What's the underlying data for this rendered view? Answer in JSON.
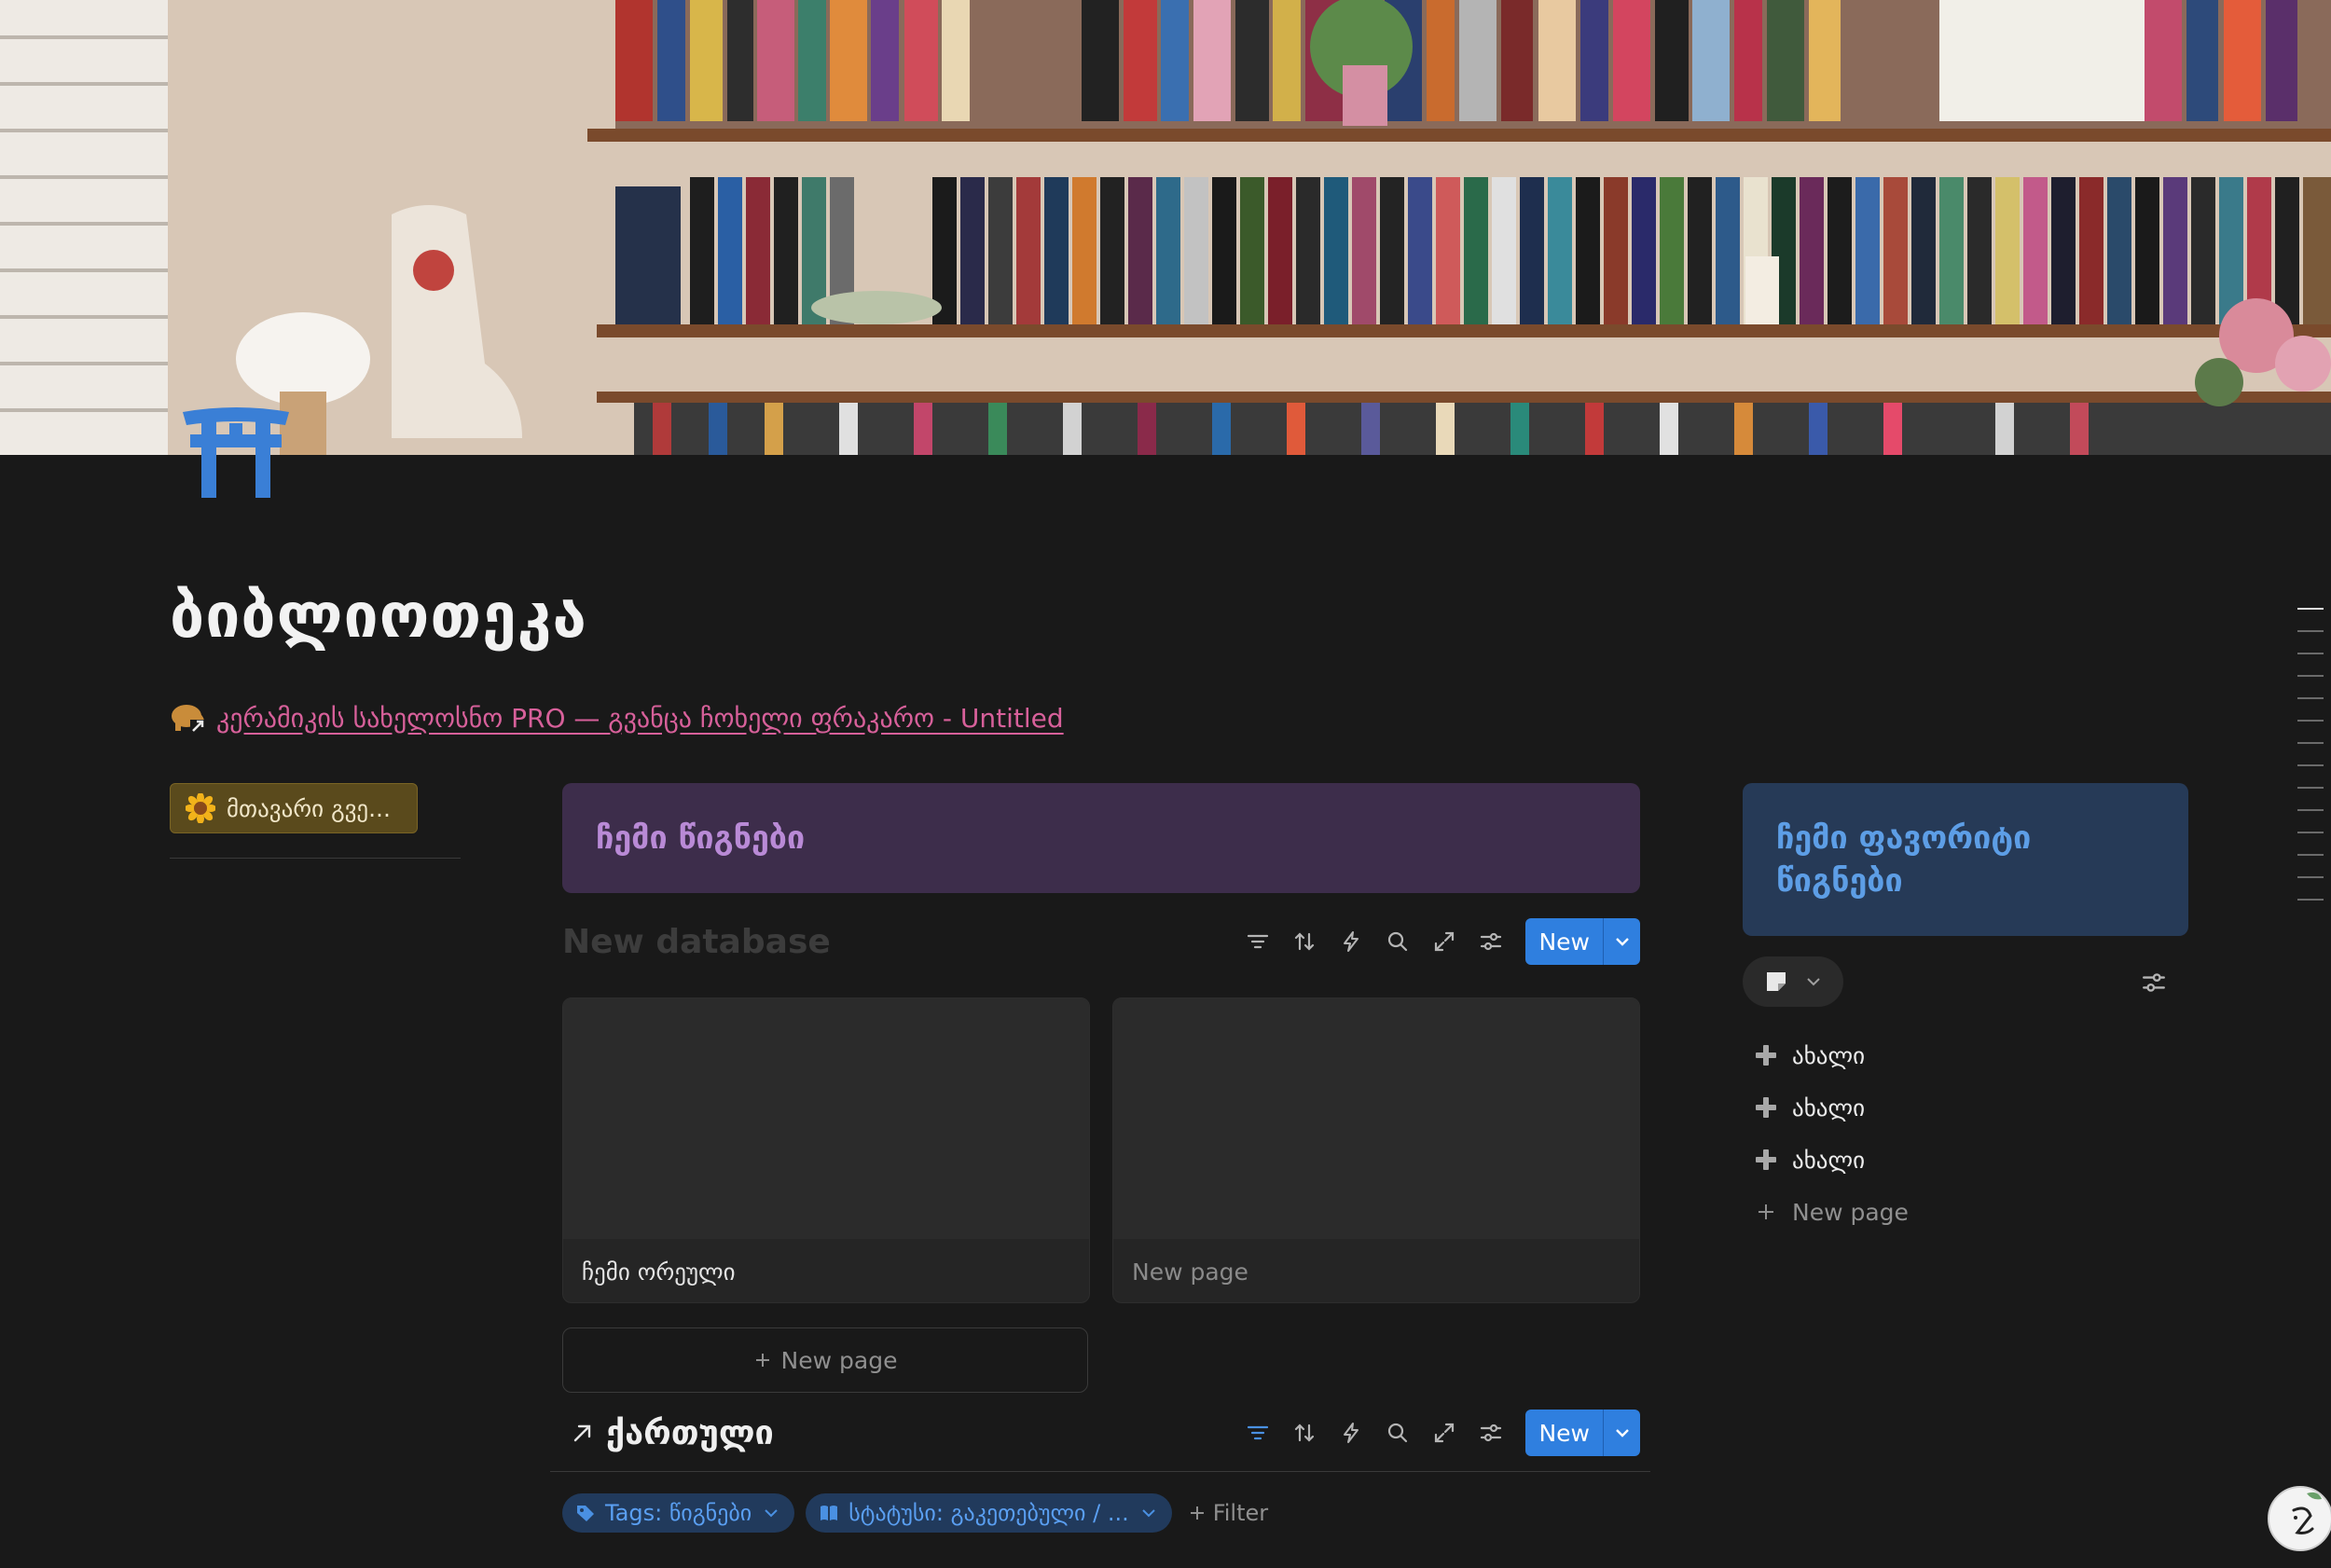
{
  "page": {
    "title": "ბიბლიოთეკა",
    "cover_description_icon": "bookshelf-cover-image",
    "page_icon": "torii-gate-icon"
  },
  "link": {
    "icon": "elephant-link-icon",
    "text": "კერამიკის სახელოსნო PRO — გვანცა ჩოხელი ფრაკარო - Untitled"
  },
  "left": {
    "home_button_icon": "sunflower-icon",
    "home_button_label": "მთავარი გვე..."
  },
  "middle": {
    "callout_title": "ჩემი წიგნები",
    "database_title": "New database",
    "new_label": "New",
    "cards": [
      {
        "caption": "ჩემი ორეული"
      },
      {
        "caption": "New page"
      }
    ],
    "new_page_label": "New page",
    "linked_db_title": "ქართული",
    "linked_new_label": "New",
    "filters": [
      {
        "icon": "tag-icon",
        "label": "Tags: წიგნები"
      },
      {
        "icon": "book-icon",
        "label": "სტატუსი: გაკეთებული / ..."
      }
    ],
    "add_filter_label": "Filter"
  },
  "right": {
    "callout_title_line1": "ჩემი ფავორიტი",
    "callout_title_line2": "წიგნები",
    "items": [
      {
        "label": "ახალი"
      },
      {
        "label": "ახალი"
      },
      {
        "label": "ახალი"
      }
    ],
    "new_page_label": "New page"
  },
  "colors": {
    "background": "#191919",
    "accent_blue": "#2f7fdf",
    "link_pink": "#d7609a",
    "callout_purple": "#3d2d4b",
    "callout_blue": "#263a57"
  }
}
